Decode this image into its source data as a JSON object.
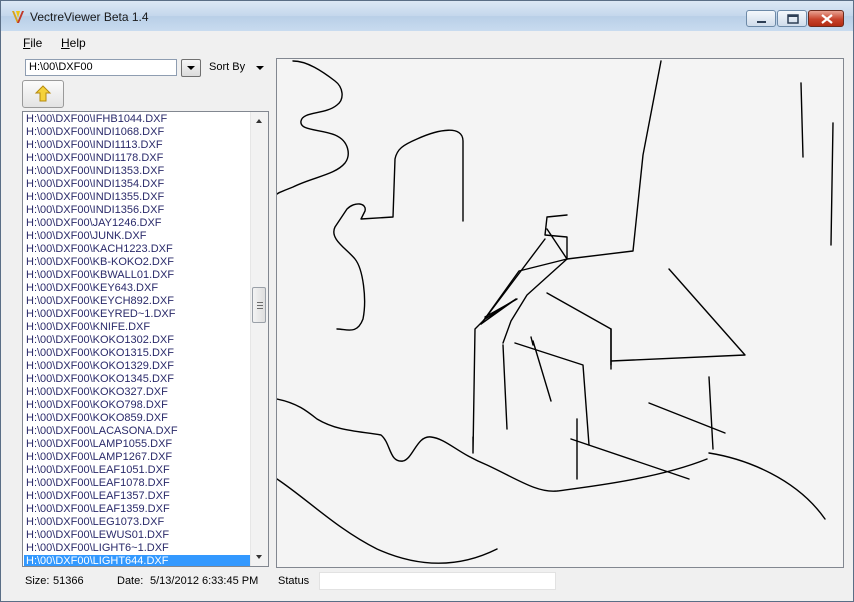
{
  "window": {
    "title": "VectreViewer Beta 1.4"
  },
  "menu": {
    "file": "F",
    "file_rest": "ile",
    "help": "H",
    "help_rest": "elp"
  },
  "left_panel": {
    "path": "H:\\00\\DXF00",
    "sort_label": "Sort By",
    "up_icon": "up-arrow-icon",
    "files": [
      "H:\\00\\DXF00\\IFHB1044.DXF",
      "H:\\00\\DXF00\\INDI1068.DXF",
      "H:\\00\\DXF00\\INDI1113.DXF",
      "H:\\00\\DXF00\\INDI1178.DXF",
      "H:\\00\\DXF00\\INDI1353.DXF",
      "H:\\00\\DXF00\\INDI1354.DXF",
      "H:\\00\\DXF00\\INDI1355.DXF",
      "H:\\00\\DXF00\\INDI1356.DXF",
      "H:\\00\\DXF00\\JAY1246.DXF",
      "H:\\00\\DXF00\\JUNK.DXF",
      "H:\\00\\DXF00\\KACH1223.DXF",
      "H:\\00\\DXF00\\KB-KOKO2.DXF",
      "H:\\00\\DXF00\\KBWALL01.DXF",
      "H:\\00\\DXF00\\KEY643.DXF",
      "H:\\00\\DXF00\\KEYCH892.DXF",
      "H:\\00\\DXF00\\KEYRED~1.DXF",
      "H:\\00\\DXF00\\KNIFE.DXF",
      "H:\\00\\DXF00\\KOKO1302.DXF",
      "H:\\00\\DXF00\\KOKO1315.DXF",
      "H:\\00\\DXF00\\KOKO1329.DXF",
      "H:\\00\\DXF00\\KOKO1345.DXF",
      "H:\\00\\DXF00\\KOKO327.DXF",
      "H:\\00\\DXF00\\KOKO798.DXF",
      "H:\\00\\DXF00\\KOKO859.DXF",
      "H:\\00\\DXF00\\LACASONA.DXF",
      "H:\\00\\DXF00\\LAMP1055.DXF",
      "H:\\00\\DXF00\\LAMP1267.DXF",
      "H:\\00\\DXF00\\LEAF1051.DXF",
      "H:\\00\\DXF00\\LEAF1078.DXF",
      "H:\\00\\DXF00\\LEAF1357.DXF",
      "H:\\00\\DXF00\\LEAF1359.DXF",
      "H:\\00\\DXF00\\LEG1073.DXF",
      "H:\\00\\DXF00\\LEWUS01.DXF",
      "H:\\00\\DXF00\\LIGHT6~1.DXF",
      "H:\\00\\DXF00\\LIGHT644.DXF"
    ],
    "selected_index": 34
  },
  "toolbar": {
    "icons": [
      "zoom-in-icon",
      "zoom-out-icon",
      "pan-hand-icon",
      "fit-extents-icon"
    ]
  },
  "status": {
    "size_label": "Size:",
    "size_value": "51366",
    "date_label": "Date:",
    "date_value": "5/13/2012 6:33:45 PM",
    "status_label": "Status",
    "status_value": ""
  }
}
